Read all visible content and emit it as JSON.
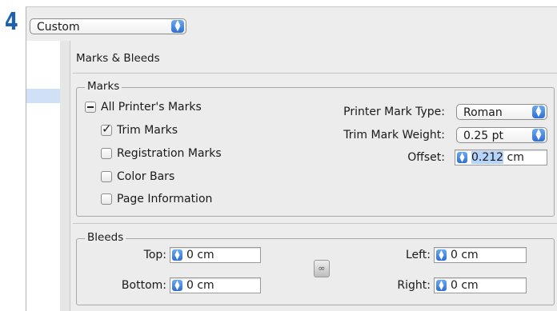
{
  "step_number": "4",
  "preset": {
    "value": "Custom"
  },
  "panel": {
    "title": "Marks & Bleeds"
  },
  "marks": {
    "group_label": "Marks",
    "all_printers_marks": {
      "label": "All Printer's Marks",
      "state": "mixed"
    },
    "trim_marks": {
      "label": "Trim Marks",
      "checked": true
    },
    "registration_marks": {
      "label": "Registration Marks",
      "checked": false
    },
    "color_bars": {
      "label": "Color Bars",
      "checked": false
    },
    "page_information": {
      "label": "Page Information",
      "checked": false
    },
    "printer_mark_type": {
      "label": "Printer Mark Type:",
      "value": "Roman"
    },
    "trim_mark_weight": {
      "label": "Trim Mark Weight:",
      "value": "0.25 pt"
    },
    "offset": {
      "label": "Offset:",
      "value_number": "0.212",
      "unit": " cm"
    }
  },
  "bleeds": {
    "group_label": "Bleeds",
    "top": {
      "label": "Top:",
      "value": "0 cm"
    },
    "bottom": {
      "label": "Bottom:",
      "value": "0 cm"
    },
    "left": {
      "label": "Left:",
      "value": "0 cm"
    },
    "right": {
      "label": "Right:",
      "value": "0 cm"
    },
    "link_icon": "chain-link-icon"
  },
  "colors": {
    "accent": "#2f6ed6",
    "step_number": "#1f5fb0"
  }
}
